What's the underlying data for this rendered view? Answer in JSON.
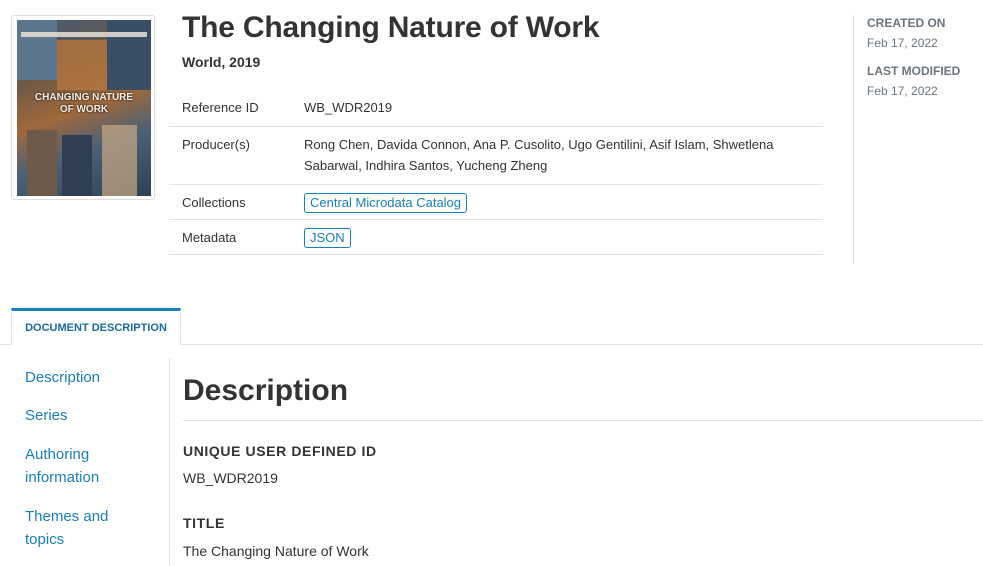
{
  "study": {
    "title": "The Changing Nature of Work",
    "subtitle": "World, 2019",
    "cover": {
      "title_line1": "CHANGING NATURE",
      "title_line2": "OF WORK"
    }
  },
  "metadata_table": {
    "reference_id": {
      "label": "Reference ID",
      "value": "WB_WDR2019"
    },
    "producers": {
      "label": "Producer(s)",
      "value_line1": "Rong Chen, Davida Connon, Ana P. Cusolito, Ugo Gentilini, Asif Islam, Shwetlena",
      "value_line2": "Sabarwal, Indhira Santos, Yucheng Zheng"
    },
    "collections": {
      "label": "Collections",
      "value": "Central Microdata Catalog"
    },
    "metadata": {
      "label": "Metadata",
      "value": "JSON"
    }
  },
  "side_info": {
    "created_label": "CREATED ON",
    "created_value": "Feb 17, 2022",
    "modified_label": "LAST MODIFIED",
    "modified_value": "Feb 17, 2022"
  },
  "tabs": {
    "active": "DOCUMENT DESCRIPTION"
  },
  "sidebar_nav": {
    "description": "Description",
    "series": "Series",
    "authoring_1": "Authoring",
    "authoring_2": "information",
    "themes_1": "Themes and",
    "themes_2": "topics"
  },
  "content": {
    "heading": "Description",
    "fields": {
      "uid_label": "UNIQUE USER DEFINED ID",
      "uid_value": "WB_WDR2019",
      "title_label": "TITLE",
      "title_value": "The Changing Nature of Work"
    }
  },
  "colors": {
    "accent": "#1a7fb7",
    "text": "#333333",
    "muted": "#6c757d",
    "border": "#dee2e6"
  }
}
